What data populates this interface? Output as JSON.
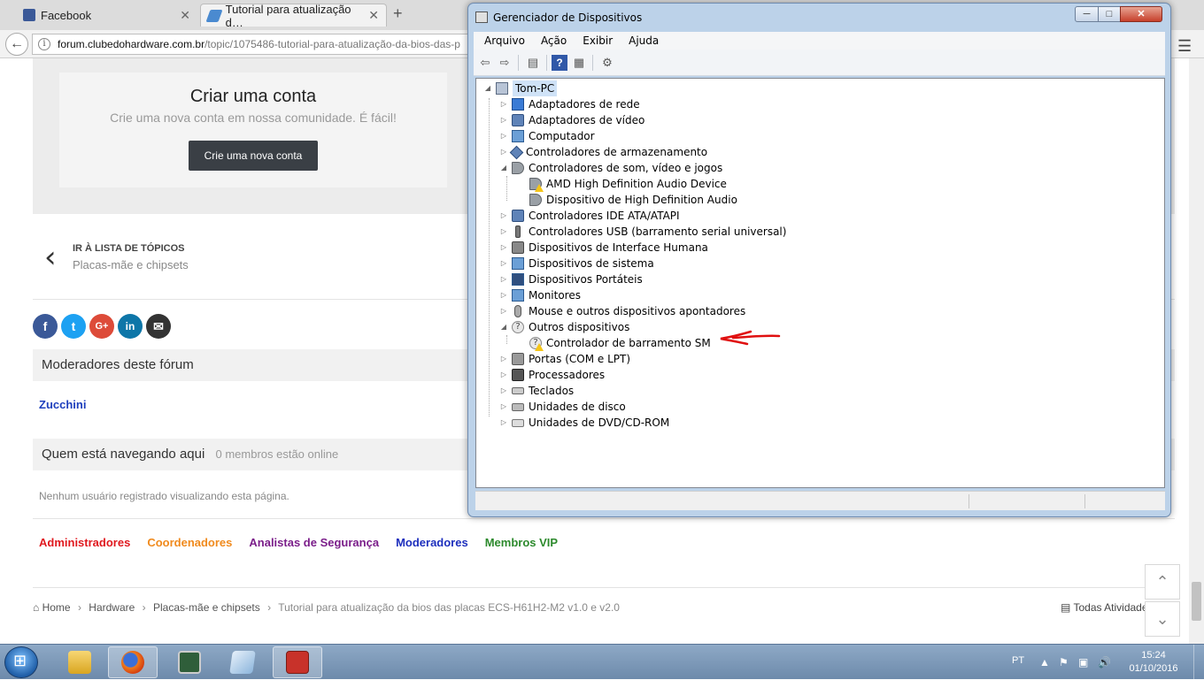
{
  "browser": {
    "tabs": [
      {
        "label": "Facebook",
        "close": "✕"
      },
      {
        "label": "Tutorial para atualização d…",
        "close": "✕"
      }
    ],
    "new_tab": "+",
    "url_host": "forum.clubedohardware.com.br",
    "url_path": "/topic/1075486-tutorial-para-atualização-da-bios-das-p"
  },
  "forum": {
    "create_title": "Criar uma conta",
    "create_sub": "Crie uma nova conta em nossa comunidade. É fácil!",
    "create_button": "Crie uma nova conta",
    "back_label": "IR À LISTA DE TÓPICOS",
    "back_sub": "Placas-mãe e chipsets",
    "share": [
      "f",
      "t",
      "G+",
      "in",
      "✉"
    ],
    "mods_title": "Moderadores deste fórum",
    "moderator": "Zucchini",
    "browsing_title": "Quem está navegando aqui",
    "browsing_count": "0 membros estão online",
    "no_users": "Nenhum usuário registrado visualizando esta página.",
    "groups": [
      {
        "label": "Administradores",
        "color": "#e0191f"
      },
      {
        "label": "Coordenadores",
        "color": "#f08a1d"
      },
      {
        "label": "Analistas de Segurança",
        "color": "#7b1e8a"
      },
      {
        "label": "Moderadores",
        "color": "#1d2fbd"
      },
      {
        "label": "Membros VIP",
        "color": "#2d8a2d"
      }
    ],
    "breadcrumb": [
      "Home",
      "Hardware",
      "Placas-mãe e chipsets",
      "Tutorial para atualização da bios das placas ECS-H61H2-M2 v1.0 e v2.0"
    ],
    "all_activity": "Todas Atividade"
  },
  "devmgr": {
    "title": "Gerenciador de Dispositivos",
    "menu": [
      "Arquivo",
      "Ação",
      "Exibir",
      "Ajuda"
    ],
    "root": "Tom-PC",
    "items": [
      {
        "label": "Adaptadores de rede",
        "level": 1,
        "icon": "net",
        "exp": "▷"
      },
      {
        "label": "Adaptadores de vídeo",
        "level": 1,
        "icon": "dev",
        "exp": "▷"
      },
      {
        "label": "Computador",
        "level": 1,
        "icon": "comp",
        "exp": "▷"
      },
      {
        "label": "Controladores de armazenamento",
        "level": 1,
        "icon": "dev",
        "exp": "▷"
      },
      {
        "label": "Controladores de som, vídeo e jogos",
        "level": 1,
        "icon": "snd",
        "exp": "◢"
      },
      {
        "label": "AMD High Definition Audio Device",
        "level": 2,
        "icon": "snd",
        "warn": true
      },
      {
        "label": "Dispositivo de High Definition Audio",
        "level": 2,
        "icon": "snd"
      },
      {
        "label": "Controladores IDE ATA/ATAPI",
        "level": 1,
        "icon": "dev",
        "exp": "▷"
      },
      {
        "label": "Controladores USB (barramento serial universal)",
        "level": 1,
        "icon": "dev",
        "exp": "▷"
      },
      {
        "label": "Dispositivos de Interface Humana",
        "level": 1,
        "icon": "dev",
        "exp": "▷"
      },
      {
        "label": "Dispositivos de sistema",
        "level": 1,
        "icon": "comp",
        "exp": "▷"
      },
      {
        "label": "Dispositivos Portáteis",
        "level": 1,
        "icon": "comp",
        "exp": "▷"
      },
      {
        "label": "Monitores",
        "level": 1,
        "icon": "comp",
        "exp": "▷"
      },
      {
        "label": "Mouse e outros dispositivos apontadores",
        "level": 1,
        "icon": "dev",
        "exp": "▷"
      },
      {
        "label": "Outros dispositivos",
        "level": 1,
        "icon": "unk",
        "exp": "◢"
      },
      {
        "label": "Controlador de barramento SM",
        "level": 2,
        "icon": "unk",
        "warn": true
      },
      {
        "label": "Portas (COM e LPT)",
        "level": 1,
        "icon": "dev",
        "exp": "▷"
      },
      {
        "label": "Processadores",
        "level": 1,
        "icon": "dev",
        "exp": "▷"
      },
      {
        "label": "Teclados",
        "level": 1,
        "icon": "dev",
        "exp": "▷"
      },
      {
        "label": "Unidades de disco",
        "level": 1,
        "icon": "dev",
        "exp": "▷"
      },
      {
        "label": "Unidades de DVD/CD-ROM",
        "level": 1,
        "icon": "dev",
        "exp": "▷"
      }
    ]
  },
  "taskbar": {
    "lang": "PT",
    "time": "15:24",
    "date": "01/10/2016"
  }
}
